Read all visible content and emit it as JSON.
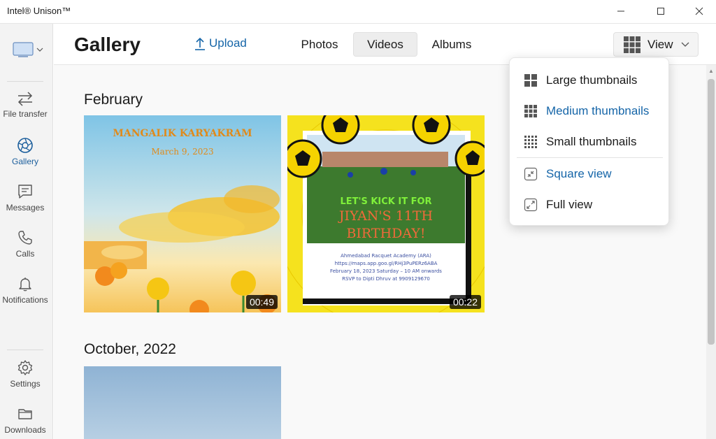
{
  "app": {
    "title": "Intel® Unison™"
  },
  "sidebar": {
    "items": [
      {
        "label": "File transfer",
        "icon": "transfer-icon"
      },
      {
        "label": "Gallery",
        "icon": "gallery-icon"
      },
      {
        "label": "Messages",
        "icon": "message-icon"
      },
      {
        "label": "Calls",
        "icon": "phone-icon"
      },
      {
        "label": "Notifications",
        "icon": "bell-icon"
      },
      {
        "label": "Settings",
        "icon": "gear-icon"
      },
      {
        "label": "Downloads",
        "icon": "folder-icon"
      }
    ],
    "active": "Gallery"
  },
  "header": {
    "title": "Gallery",
    "upload_label": "Upload",
    "tabs": [
      "Photos",
      "Videos",
      "Albums"
    ],
    "selected_tab": "Videos",
    "view_label": "View"
  },
  "view_menu": {
    "items": [
      {
        "label": "Large thumbnails",
        "icon": "large-grid-icon",
        "selected": false
      },
      {
        "label": "Medium thumbnails",
        "icon": "medium-grid-icon",
        "selected": true
      },
      {
        "label": "Small thumbnails",
        "icon": "small-grid-icon",
        "selected": false
      },
      {
        "label": "Square view",
        "icon": "square-view-icon",
        "selected": true
      },
      {
        "label": "Full view",
        "icon": "full-view-icon",
        "selected": false
      }
    ]
  },
  "gallery": {
    "sections": [
      {
        "title": "February",
        "videos": [
          {
            "duration": "00:49",
            "text": {
              "heading": "MANGALIK KARYAKRAM",
              "date": "March 9, 2023"
            }
          },
          {
            "duration": "00:22",
            "text": {
              "line1": "LET'S KICK IT FOR",
              "line2": "JIYAN'S 11TH",
              "line3": "BIRTHDAY!",
              "details": [
                "Ahmedabad Racquet Academy (ARA)",
                "https://maps.app.goo.gl/RHj3PuPERz6ABA",
                "February 18, 2023 Saturday – 10 AM onwards",
                "RSVP to Dipti Dhruv at 9909129670"
              ]
            }
          }
        ]
      },
      {
        "title": "October, 2022",
        "videos": [
          {}
        ]
      }
    ]
  },
  "colors": {
    "accent": "#1565a8",
    "sidebar_bg": "#f3f3f3",
    "content_bg": "#f9f9f9"
  }
}
